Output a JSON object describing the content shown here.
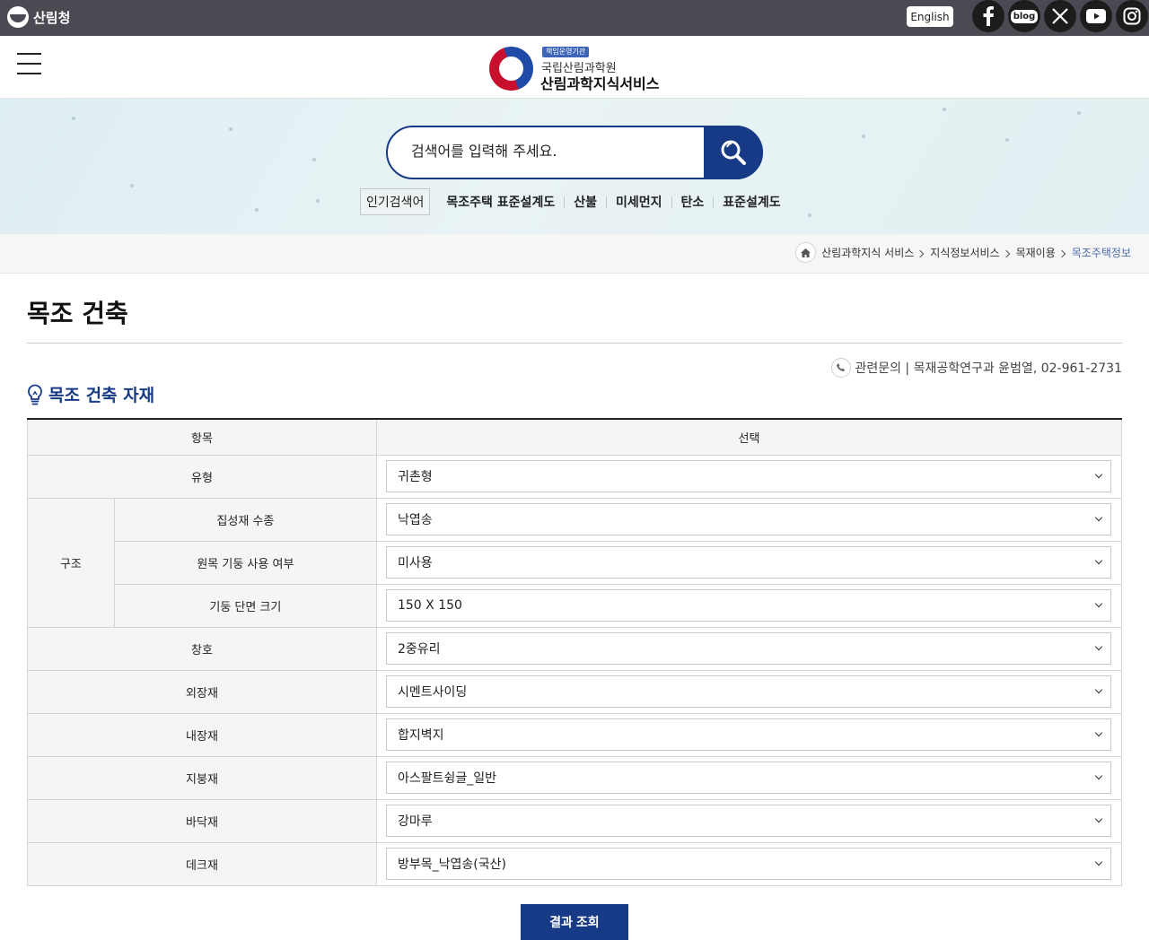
{
  "topbar": {
    "gov_name": "산림청",
    "english_label": "English",
    "sns": [
      {
        "name": "facebook-icon",
        "glyph": "f"
      },
      {
        "name": "blog-icon",
        "glyph": "blog"
      },
      {
        "name": "x-icon",
        "glyph": "𝕏"
      },
      {
        "name": "youtube-icon",
        "glyph": "▶"
      },
      {
        "name": "instagram-icon",
        "glyph": ""
      }
    ]
  },
  "header": {
    "tag": "책임운영기관",
    "org": "국립산림과학원",
    "site_name": "산림과학지식서비스"
  },
  "search": {
    "placeholder": "검색어를 입력해 주세요.",
    "popular_label": "인기검색어",
    "keywords": [
      "목조주택 표준설계도",
      "산불",
      "미세먼지",
      "탄소",
      "표준설계도"
    ]
  },
  "breadcrumb": [
    "산림과학지식 서비스",
    "지식정보서비스",
    "목재이용",
    "목조주택정보"
  ],
  "page": {
    "title": "목조 건축",
    "contact": "관련문의 | 목재공학연구과 윤범열, 02-961-2731",
    "section_title": "목조 건축 자재"
  },
  "table": {
    "col_item": "항목",
    "col_select": "선택",
    "structure_label": "구조",
    "rows": [
      {
        "label": "유형",
        "value": "귀촌형"
      },
      {
        "label": "집성재 수종",
        "value": "낙엽송"
      },
      {
        "label": "원목 기둥 사용 여부",
        "value": "미사용"
      },
      {
        "label": "기둥 단면 크기",
        "value": "150 X 150"
      },
      {
        "label": "창호",
        "value": "2중유리"
      },
      {
        "label": "외장재",
        "value": "시멘트사이딩"
      },
      {
        "label": "내장재",
        "value": "합지벽지"
      },
      {
        "label": "지붕재",
        "value": "아스팔트슁글_일반"
      },
      {
        "label": "바닥재",
        "value": "강마루"
      },
      {
        "label": "데크재",
        "value": "방부목_낙엽송(국산)"
      }
    ]
  },
  "submit_label": "결과 조회",
  "colors": {
    "topbar": "#4a4a52",
    "primary": "#173a86",
    "band": "#e3eff2"
  }
}
